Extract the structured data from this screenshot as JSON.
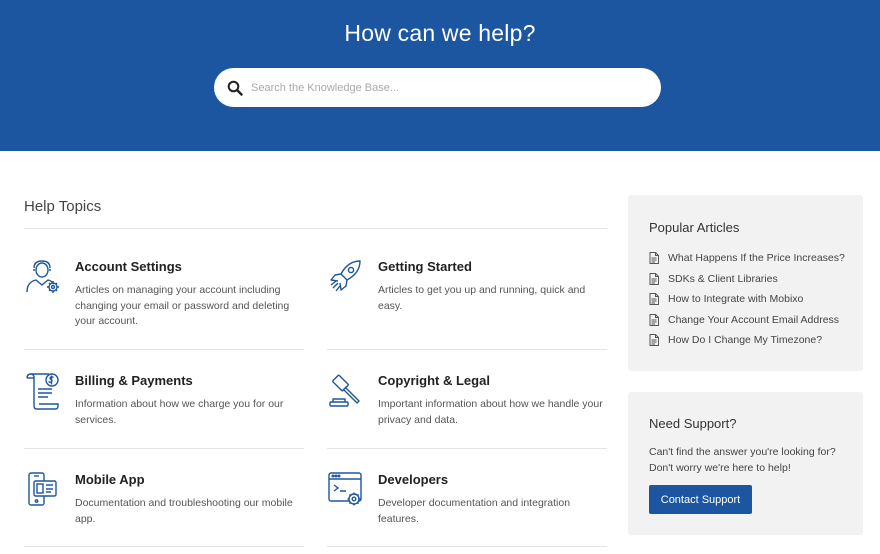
{
  "hero": {
    "title": "How can we help?",
    "search_placeholder": "Search the Knowledge Base..."
  },
  "help_topics": {
    "heading": "Help Topics",
    "items": [
      {
        "title": "Account Settings",
        "description": "Articles on managing your account including changing your email or password and deleting your account.",
        "icon": "account-settings-icon"
      },
      {
        "title": "Getting Started",
        "description": "Articles to get you up and running, quick and easy.",
        "icon": "rocket-icon"
      },
      {
        "title": "Billing & Payments",
        "description": "Information about how we charge you for our services.",
        "icon": "billing-icon"
      },
      {
        "title": "Copyright & Legal",
        "description": "Important information about how we handle your privacy and data.",
        "icon": "gavel-icon"
      },
      {
        "title": "Mobile App",
        "description": "Documentation and troubleshooting our mobile app.",
        "icon": "mobile-app-icon"
      },
      {
        "title": "Developers",
        "description": "Developer documentation and integration features.",
        "icon": "developer-icon"
      }
    ]
  },
  "popular_articles": {
    "title": "Popular Articles",
    "items": [
      "What Happens If the Price Increases?",
      "SDKs & Client Libraries",
      "How to Integrate with Mobixo",
      "Change Your Account Email Address",
      "How Do I Change My Timezone?"
    ]
  },
  "support": {
    "title": "Need Support?",
    "text": "Can't find the answer you're looking for? Don't worry we're here to help!",
    "button_label": "Contact Support"
  },
  "colors": {
    "brand_blue": "#1d56a0",
    "card_bg": "#f2f2f2",
    "icon_blue": "#1d56a0"
  }
}
